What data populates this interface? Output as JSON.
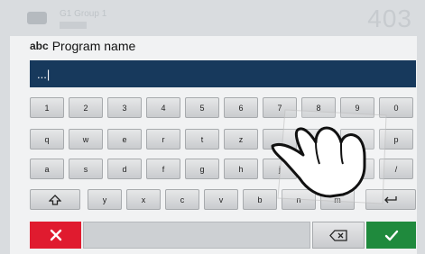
{
  "background": {
    "header_line1": "G1   Group 1",
    "header_number": "403"
  },
  "dialog": {
    "title_prefix": "abc",
    "title": "Program name",
    "input_value": "...|"
  },
  "keyboard": {
    "row1": [
      "1",
      "2",
      "3",
      "4",
      "5",
      "6",
      "7",
      "8",
      "9",
      "0"
    ],
    "row2": [
      "q",
      "w",
      "e",
      "r",
      "t",
      "z",
      "",
      "",
      "o",
      "p"
    ],
    "row3": [
      "a",
      "s",
      "d",
      "f",
      "g",
      "h",
      "j",
      "",
      "",
      "/"
    ],
    "row4": [
      "y",
      "x",
      "c",
      "v",
      "b",
      "n",
      "m"
    ],
    "shift_icon": "shift-arrow-icon",
    "enter_icon": "enter-arrow-icon"
  },
  "actions": {
    "cancel_icon": "x-mark-icon",
    "delete_icon": "backspace-icon",
    "confirm_icon": "check-mark-icon"
  },
  "colors": {
    "input_bar": "#17395c",
    "cancel": "#e01b2f",
    "confirm": "#1f8a3d"
  }
}
